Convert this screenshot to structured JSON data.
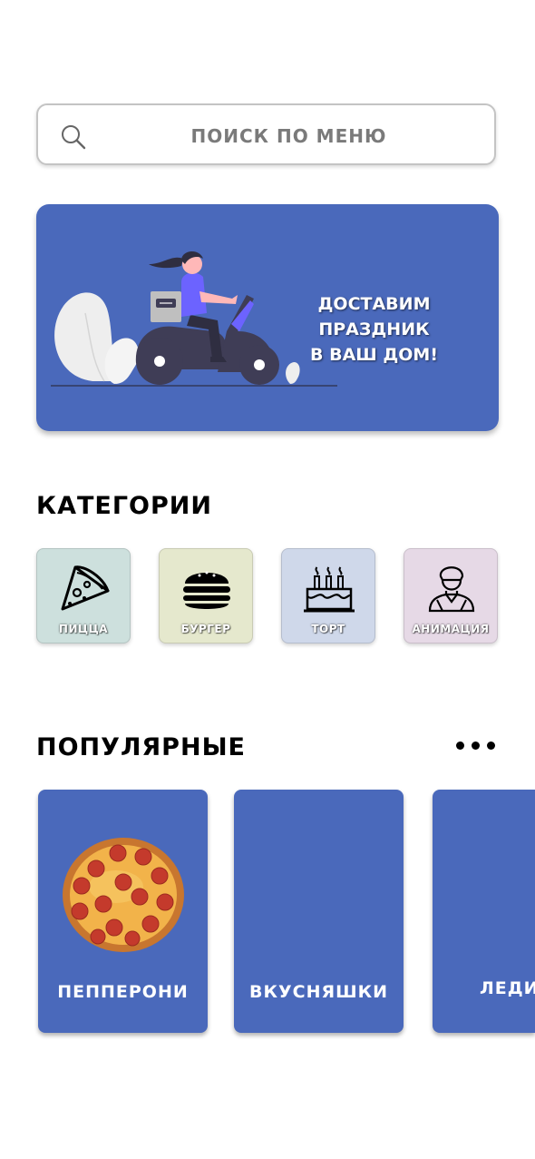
{
  "search": {
    "placeholder": "ПОИСК ПО МЕНЮ",
    "value": "",
    "icon": "search-icon"
  },
  "banner": {
    "line1": "ДОСТАВИМ ПРАЗДНИК",
    "line2": "В ВАШ ДОМ!",
    "illustration": "delivery-scooter-illustration"
  },
  "categories": {
    "title": "КАТЕГОРИИ",
    "items": [
      {
        "label": "ПИЦЦА",
        "icon": "pizza-icon",
        "color": "#cde0dd"
      },
      {
        "label": "БУРГЕР",
        "icon": "burger-icon",
        "color": "#e5e8cd"
      },
      {
        "label": "ТОРТ",
        "icon": "cake-icon",
        "color": "#cfd8ea"
      },
      {
        "label": "АНИМАЦИЯ",
        "icon": "animator-icon",
        "color": "#e6d9e6"
      }
    ]
  },
  "popular": {
    "title": "ПОПУЛЯРНЫЕ",
    "more_icon": "more-dots-icon",
    "items": [
      {
        "label": "ПЕППЕРОНИ",
        "image": "pepperoni-pizza-image"
      },
      {
        "label": "ВКУСНЯШКИ"
      },
      {
        "label": "ЛЕДИ"
      }
    ]
  },
  "colors": {
    "accent": "#4a69bb",
    "text": "#000000"
  }
}
